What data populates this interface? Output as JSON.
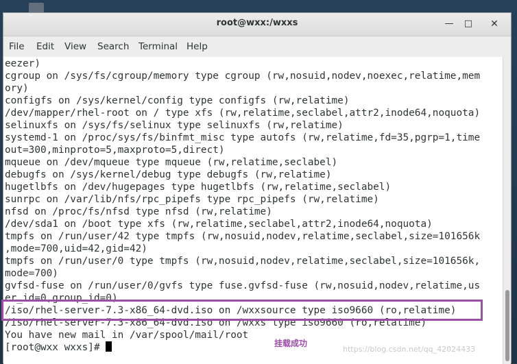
{
  "window": {
    "title": "root@wxx:/wxxs",
    "minimize_glyph": "—",
    "maximize_glyph": "□",
    "close_glyph": "✕"
  },
  "menu": [
    "File",
    "Edit",
    "View",
    "Search",
    "Terminal",
    "Help"
  ],
  "terminal": {
    "lines": [
      "eezer)",
      "cgroup on /sys/fs/cgroup/memory type cgroup (rw,nosuid,nodev,noexec,relatime,mem",
      "ory)",
      "configfs on /sys/kernel/config type configfs (rw,relatime)",
      "/dev/mapper/rhel-root on / type xfs (rw,relatime,seclabel,attr2,inode64,noquota)",
      "selinuxfs on /sys/fs/selinux type selinuxfs (rw,relatime)",
      "systemd-1 on /proc/sys/fs/binfmt_misc type autofs (rw,relatime,fd=35,pgrp=1,time",
      "out=300,minproto=5,maxproto=5,direct)",
      "mqueue on /dev/mqueue type mqueue (rw,relatime,seclabel)",
      "debugfs on /sys/kernel/debug type debugfs (rw,relatime)",
      "hugetlbfs on /dev/hugepages type hugetlbfs (rw,relatime,seclabel)",
      "sunrpc on /var/lib/nfs/rpc_pipefs type rpc_pipefs (rw,relatime)",
      "nfsd on /proc/fs/nfsd type nfsd (rw,relatime)",
      "/dev/sda1 on /boot type xfs (rw,relatime,seclabel,attr2,inode64,noquota)",
      "tmpfs on /run/user/42 type tmpfs (rw,nosuid,nodev,relatime,seclabel,size=101656k",
      ",mode=700,uid=42,gid=42)",
      "tmpfs on /run/user/0 type tmpfs (rw,nosuid,nodev,relatime,seclabel,size=101656k,",
      "mode=700)",
      "gvfsd-fuse on /run/user/0/gvfs type fuse.gvfsd-fuse (rw,nosuid,nodev,relatime,us",
      "er_id=0,group_id=0)",
      "/iso/rhel-server-7.3-x86_64-dvd.iso on /wxxsource type iso9660 (ro,relatime)",
      "/iso/rhel-server-7.3-x86_64-dvd.iso on /wxxs type iso9660 (ro,relatime)",
      "You have new mail in /var/spool/mail/root"
    ],
    "prompt": "[root@wxx wxxs]# "
  },
  "annotation": {
    "text": "挂载成功",
    "color": "#9b4fa6"
  },
  "watermark": "https://blog.csdn.net/qq_42024433"
}
